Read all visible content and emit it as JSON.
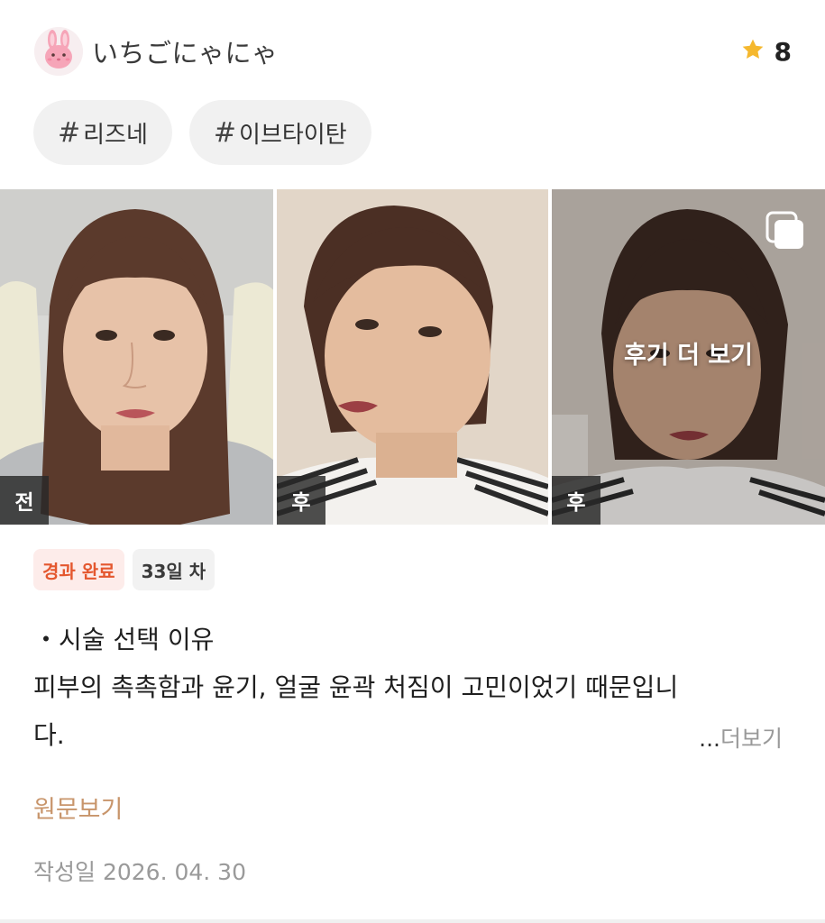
{
  "author": {
    "name": "いちごにゃにゃ",
    "avatar_icon": "bunny-avatar-icon"
  },
  "rating": {
    "icon": "star-icon",
    "value": "8",
    "star_color": "#f5b82e"
  },
  "tags": [
    {
      "hash": "#",
      "label": "리즈네"
    },
    {
      "hash": "#",
      "label": "이브타이탄"
    }
  ],
  "photos": [
    {
      "tag": "전"
    },
    {
      "tag": "후"
    },
    {
      "tag": "후",
      "overlay": "후기 더 보기",
      "overlay_icon": "multiple-images-icon"
    }
  ],
  "badges": {
    "status": "경과 완료",
    "day": "33일 차",
    "status_color": "#e4572e"
  },
  "review": {
    "line1": "・시술 선택 이유",
    "line2": "피부의 촉촉함과 윤기, 얼굴 윤곽 처짐이 고민이었기 때문입니",
    "line3": "다.",
    "more_dots": "...",
    "more_label": "더보기"
  },
  "original_link": "원문보기",
  "date": "작성일 2026. 04. 30",
  "accent_color": "#c8956b"
}
